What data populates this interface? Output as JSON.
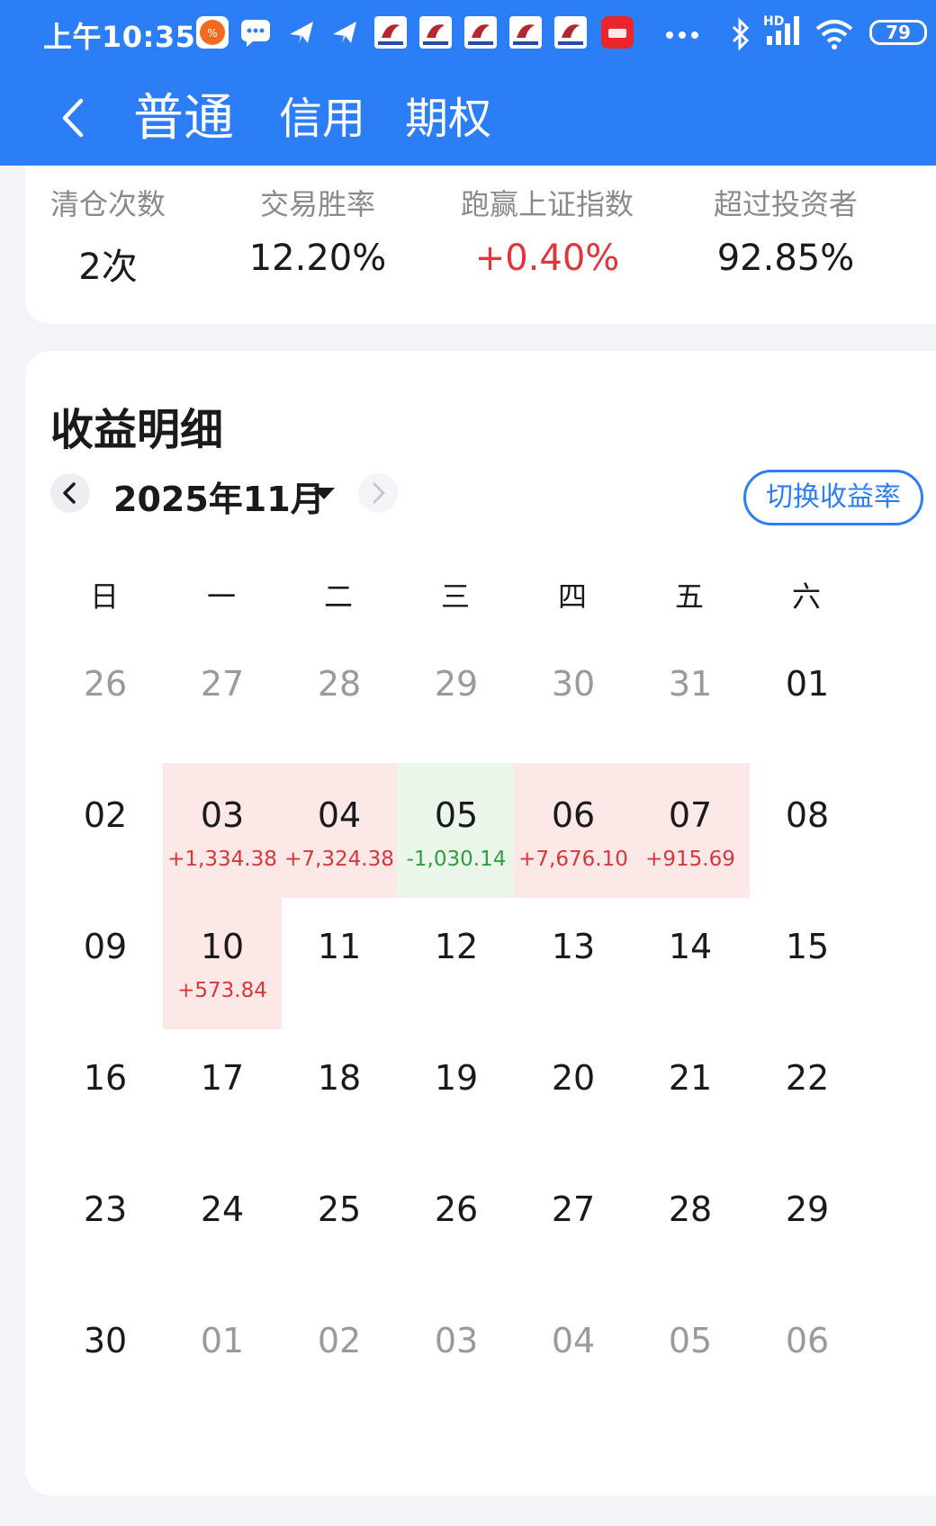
{
  "status_bar": {
    "time": "上午10:35",
    "battery": "79",
    "hd_label": "HD"
  },
  "nav": {
    "tabs": [
      {
        "label": "普通",
        "active": true
      },
      {
        "label": "信用",
        "active": false
      },
      {
        "label": "期权",
        "active": false
      }
    ]
  },
  "summary": {
    "stats": [
      {
        "label": "清仓次数",
        "value": "2次",
        "color": "#1a1a1a"
      },
      {
        "label": "交易胜率",
        "value": "12.20%",
        "color": "#1a1a1a"
      },
      {
        "label": "跑赢上证指数",
        "value": "+0.40%",
        "color": "#e0353b"
      },
      {
        "label": "超过投资者",
        "value": "92.85%",
        "color": "#1a1a1a"
      }
    ]
  },
  "detail": {
    "title": "收益明细",
    "month": "2025年11月",
    "switch_label": "切换收益率",
    "weekdays": [
      "日",
      "一",
      "二",
      "三",
      "四",
      "五",
      "六"
    ],
    "weeks": [
      [
        {
          "day": "26",
          "muted": true
        },
        {
          "day": "27",
          "muted": true
        },
        {
          "day": "28",
          "muted": true
        },
        {
          "day": "29",
          "muted": true
        },
        {
          "day": "30",
          "muted": true
        },
        {
          "day": "31",
          "muted": true
        },
        {
          "day": "01",
          "muted": false
        }
      ],
      [
        {
          "day": "02",
          "muted": false
        },
        {
          "day": "03",
          "muted": false,
          "amount": "+1,334.38",
          "type": "profit"
        },
        {
          "day": "04",
          "muted": false,
          "amount": "+7,324.38",
          "type": "profit"
        },
        {
          "day": "05",
          "muted": false,
          "amount": "-1,030.14",
          "type": "loss"
        },
        {
          "day": "06",
          "muted": false,
          "amount": "+7,676.10",
          "type": "profit"
        },
        {
          "day": "07",
          "muted": false,
          "amount": "+915.69",
          "type": "profit"
        },
        {
          "day": "08",
          "muted": false
        }
      ],
      [
        {
          "day": "09",
          "muted": false
        },
        {
          "day": "10",
          "muted": false,
          "amount": "+573.84",
          "type": "profit"
        },
        {
          "day": "11",
          "muted": false
        },
        {
          "day": "12",
          "muted": false
        },
        {
          "day": "13",
          "muted": false
        },
        {
          "day": "14",
          "muted": false
        },
        {
          "day": "15",
          "muted": false
        }
      ],
      [
        {
          "day": "16",
          "muted": false
        },
        {
          "day": "17",
          "muted": false
        },
        {
          "day": "18",
          "muted": false
        },
        {
          "day": "19",
          "muted": false
        },
        {
          "day": "20",
          "muted": false
        },
        {
          "day": "21",
          "muted": false
        },
        {
          "day": "22",
          "muted": false
        }
      ],
      [
        {
          "day": "23",
          "muted": false
        },
        {
          "day": "24",
          "muted": false
        },
        {
          "day": "25",
          "muted": false
        },
        {
          "day": "26",
          "muted": false
        },
        {
          "day": "27",
          "muted": false
        },
        {
          "day": "28",
          "muted": false
        },
        {
          "day": "29",
          "muted": false
        }
      ],
      [
        {
          "day": "30",
          "muted": false
        },
        {
          "day": "01",
          "muted": true
        },
        {
          "day": "02",
          "muted": true
        },
        {
          "day": "03",
          "muted": true
        },
        {
          "day": "04",
          "muted": true
        },
        {
          "day": "05",
          "muted": true
        },
        {
          "day": "06",
          "muted": true
        }
      ]
    ]
  },
  "colors": {
    "brand_blue": "#2b7ef5",
    "profit_text": "#d9363b",
    "profit_bg": "#fde8e8",
    "loss_text": "#2f9e3e",
    "loss_bg": "#e9f6e9"
  }
}
